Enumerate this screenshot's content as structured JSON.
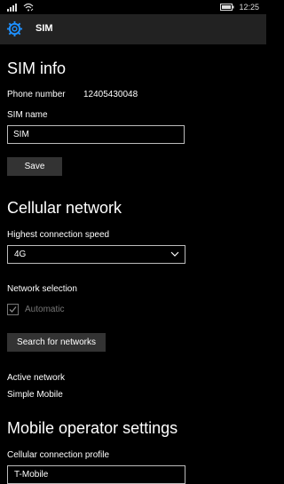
{
  "status": {
    "time": "12:25"
  },
  "header": {
    "title": "SIM"
  },
  "sim_info": {
    "heading": "SIM info",
    "phone_label": "Phone number",
    "phone_value": "12405430048",
    "name_label": "SIM name",
    "name_value": "SIM",
    "save_label": "Save"
  },
  "cellular": {
    "heading": "Cellular network",
    "speed_label": "Highest connection speed",
    "speed_value": "4G",
    "selection_label": "Network selection",
    "automatic_label": "Automatic",
    "automatic_checked": true,
    "search_label": "Search for networks",
    "active_label": "Active network",
    "active_value": "Simple Mobile"
  },
  "operator": {
    "heading": "Mobile operator settings",
    "profile_label": "Cellular connection profile",
    "profile_value": "T-Mobile"
  },
  "icons": [
    "signal-icon",
    "wifi-icon",
    "battery-icon",
    "gear-icon",
    "chevron-down-icon",
    "checkmark-icon"
  ],
  "colors": {
    "background": "#000000",
    "header": "#222222",
    "button": "#333333",
    "accent": "#1e90ff"
  }
}
